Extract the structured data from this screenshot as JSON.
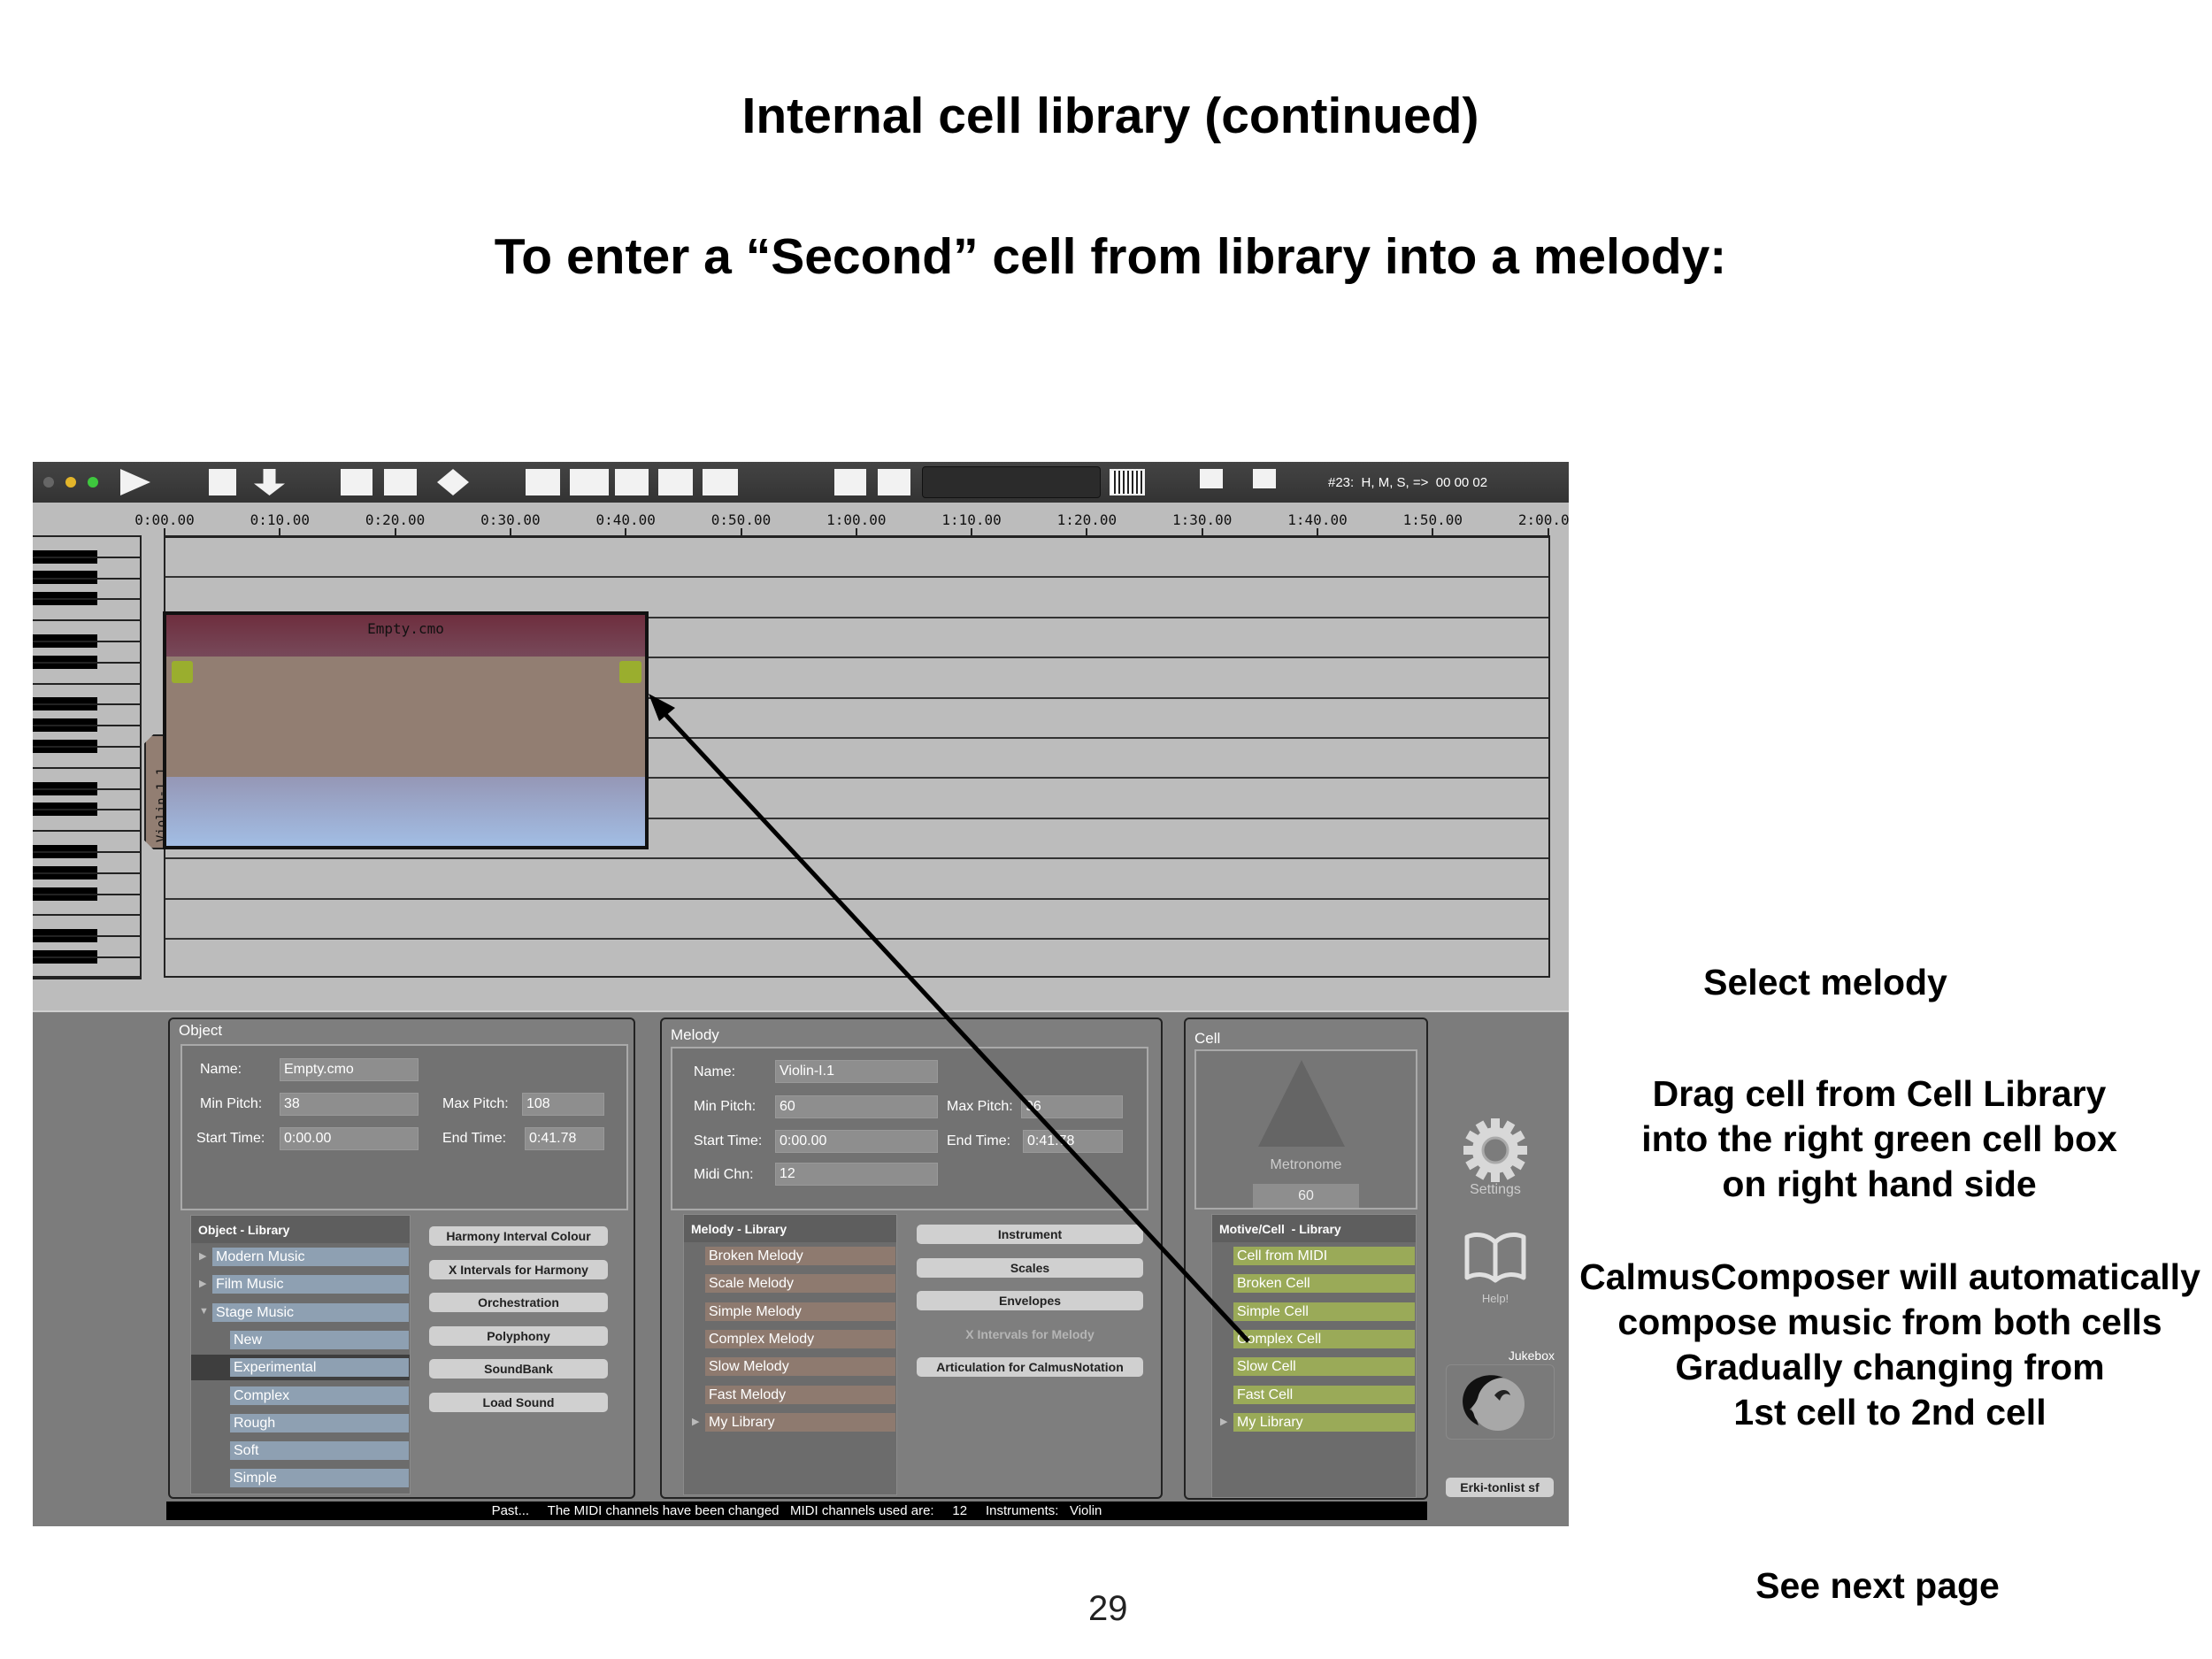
{
  "slide": {
    "title": "Internal cell library (continued)",
    "subtitle": "To enter a “Second” cell from library into a melody:",
    "notes": {
      "select": "Select melody",
      "drag": [
        "Drag cell from Cell Library",
        "into the right green cell box",
        "on right hand side"
      ],
      "auto": [
        "CalmusComposer will automatically",
        "compose music from both cells",
        "Gradually changing from",
        "1st cell to 2nd cell"
      ],
      "next": "See next page"
    },
    "page_number": "29"
  },
  "toolbar": {
    "icons": [
      "play-icon",
      "stop-icon",
      "download-arrow-icon",
      "folder-icon",
      "save-icon",
      "diamond-icon",
      "cell-insert-icon",
      "cell-move-icon",
      "cell-split-icon",
      "cell-delete-icon",
      "cell-clear-icon",
      "melody-move-icon",
      "melody-delete-icon"
    ],
    "time_readout": "#23:  H, M, S, =>  00 00 02"
  },
  "ruler": {
    "labels": [
      "0:00.00",
      "0:10.00",
      "0:20.00",
      "0:30.00",
      "0:40.00",
      "0:50.00",
      "1:00.00",
      "1:10.00",
      "1:20.00",
      "1:30.00",
      "1:40.00",
      "1:50.00",
      "2:00.00"
    ]
  },
  "timeline": {
    "object_name": "Empty.cmo",
    "melody_tab": "Violin-1.1",
    "colors": {
      "object_header": "#6e3142",
      "melody": "#927e72",
      "cell_handle": "#9aae2e",
      "lower": "#a0b8e0"
    }
  },
  "object_panel": {
    "title": "Object",
    "name_label": "Name:",
    "name_value": "Empty.cmo",
    "min_pitch_label": "Min Pitch:",
    "min_pitch_value": "38",
    "max_pitch_label": "Max Pitch:",
    "max_pitch_value": "108",
    "start_time_label": "Start Time:",
    "start_time_value": "0:00.00",
    "end_time_label": "End Time:",
    "end_time_value": "0:41.78",
    "library": {
      "title": "Object - Library",
      "items": [
        {
          "label": "Modern Music",
          "level": 0,
          "expander": "collapsed"
        },
        {
          "label": "Film Music",
          "level": 0,
          "expander": "collapsed"
        },
        {
          "label": "Stage Music",
          "level": 0,
          "expander": "expanded"
        },
        {
          "label": "New",
          "level": 1
        },
        {
          "label": "Experimental",
          "level": 1,
          "selected": true
        },
        {
          "label": "Complex",
          "level": 1
        },
        {
          "label": "Rough",
          "level": 1
        },
        {
          "label": "Soft",
          "level": 1
        },
        {
          "label": "Simple",
          "level": 1
        }
      ]
    },
    "buttons": [
      "Harmony Interval Colour",
      "X Intervals for Harmony",
      "Orchestration",
      "Polyphony",
      "SoundBank",
      "Load Sound"
    ]
  },
  "melody_panel": {
    "title": "Melody",
    "name_label": "Name:",
    "name_value": "Violin-I.1",
    "min_pitch_label": "Min Pitch:",
    "min_pitch_value": "60",
    "max_pitch_label": "Max Pitch:",
    "max_pitch_value": "96",
    "start_time_label": "Start Time:",
    "start_time_value": "0:00.00",
    "end_time_label": "End Time:",
    "end_time_value": "0:41.78",
    "midi_label": "Midi Chn:",
    "midi_value": "12",
    "library": {
      "title": "Melody - Library",
      "items": [
        {
          "label": "Broken Melody"
        },
        {
          "label": "Scale Melody"
        },
        {
          "label": "Simple Melody"
        },
        {
          "label": "Complex Melody"
        },
        {
          "label": "Slow Melody"
        },
        {
          "label": "Fast Melody"
        },
        {
          "label": "My Library",
          "expander": "collapsed"
        }
      ]
    },
    "buttons": [
      {
        "label": "Instrument",
        "enabled": true
      },
      {
        "label": "Scales",
        "enabled": true
      },
      {
        "label": "Envelopes",
        "enabled": true
      },
      {
        "label": "X Intervals for Melody",
        "enabled": false
      },
      {
        "label": "Articulation for CalmusNotation",
        "enabled": true
      }
    ]
  },
  "cell_panel": {
    "title": "Cell",
    "metronome_label": "Metronome",
    "metronome_value": "60",
    "library": {
      "title": "Motive/Cell  - Library",
      "items": [
        {
          "label": "Cell from MIDI"
        },
        {
          "label": "Broken Cell"
        },
        {
          "label": "Simple Cell"
        },
        {
          "label": "Complex Cell"
        },
        {
          "label": "Slow Cell"
        },
        {
          "label": "Fast Cell"
        },
        {
          "label": "My Library",
          "expander": "collapsed"
        }
      ]
    }
  },
  "side": {
    "settings_label": "Settings",
    "help_label": "Help!",
    "jukebox_label": "Jukebox",
    "user_button": "Erki-tonlist sf"
  },
  "status_bar": "Past...     The MIDI channels have been changed   MIDI channels used are:     12     Instruments:   Violin"
}
